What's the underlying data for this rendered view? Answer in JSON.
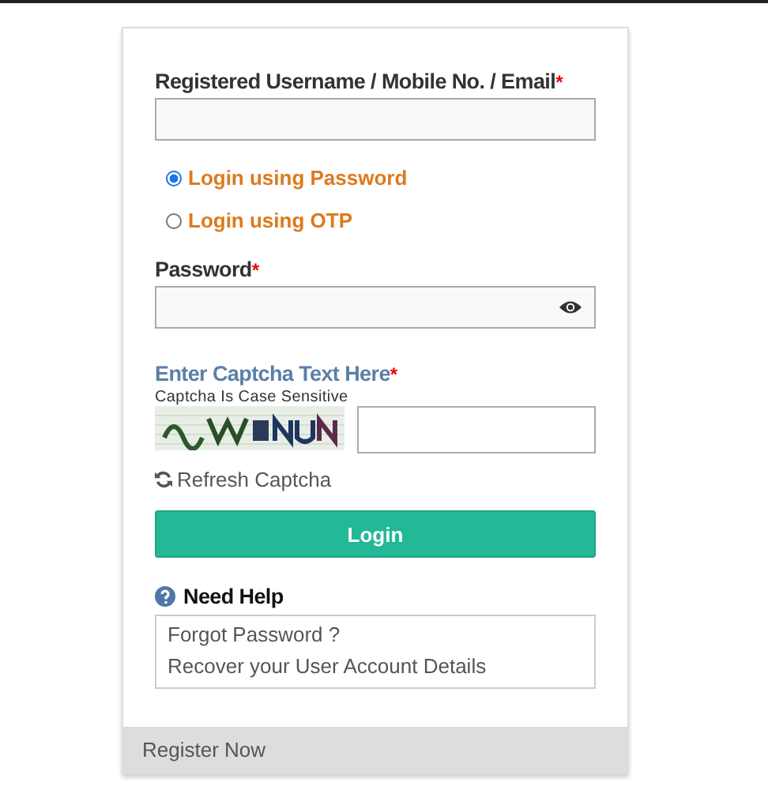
{
  "login_form": {
    "username": {
      "label": "Registered Username / Mobile No. / Email",
      "required_mark": "*"
    },
    "login_modes": [
      {
        "label": "Login using Password",
        "selected": true
      },
      {
        "label": "Login using OTP",
        "selected": false
      }
    ],
    "password": {
      "label": "Password",
      "required_mark": "*"
    },
    "captcha": {
      "label": "Enter Captcha Text Here",
      "required_mark": "*",
      "note": "Captcha Is Case Sensitive",
      "refresh": "Refresh Captcha"
    },
    "login_button": "Login",
    "help": {
      "title": "Need Help",
      "links": [
        "Forgot Password ?",
        "Recover your User Account Details"
      ]
    },
    "footer": "Register Now"
  }
}
